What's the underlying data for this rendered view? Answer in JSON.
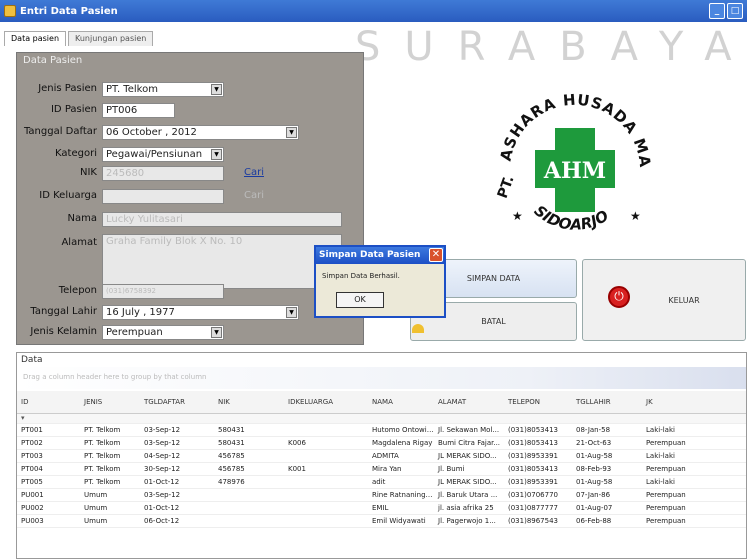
{
  "window": {
    "title": "Entri Data Pasien",
    "watermark": "SURABAYA"
  },
  "tabs": [
    {
      "label": "Data pasien"
    },
    {
      "label": "Kunjungan pasien"
    }
  ],
  "form": {
    "panel_title": "Data Pasien",
    "jenis_pasien_label": "Jenis Pasien",
    "jenis_pasien_value": "PT. Telkom",
    "id_pasien_label": "ID Pasien",
    "id_pasien_value": "PT006",
    "tanggal_daftar_label": "Tanggal Daftar",
    "tanggal_daftar_value": "06  October  , 2012",
    "kategori_label": "Kategori",
    "kategori_value": "Pegawai/Pensiunan",
    "nik_label": "NIK",
    "nik_value": "245680",
    "nik_link": "Cari",
    "id_keluarga_label": "ID Keluarga",
    "id_keluarga_value": "",
    "id_keluarga_link": "Cari",
    "nama_label": "Nama",
    "nama_value": "Lucky Yulitasari",
    "alamat_label": "Alamat",
    "alamat_value": "Graha Family Blok X No. 10",
    "telepon_label": "Telepon",
    "telepon_value": "(031)6758392",
    "tanggal_lahir_label": "Tanggal Lahir",
    "tanggal_lahir_value": "16     July     , 1977",
    "jenis_kelamin_label": "Jenis Kelamin",
    "jenis_kelamin_value": "Perempuan"
  },
  "logo": {
    "abbr": "AHM",
    "top_text": "ASHARA HUSADA MANDIRI",
    "prefix": "PT.",
    "bottom_text": "SIDOARJO"
  },
  "buttons": {
    "simpan": "SIMPAN DATA",
    "batal": "BATAL",
    "keluar": "KELUAR"
  },
  "dialog": {
    "title": "Simpan Data Pasien",
    "message": "Simpan Data Berhasil.",
    "ok": "OK"
  },
  "grid": {
    "title": "Data",
    "group_hint": "Drag a column header here to group by that column",
    "columns": [
      "ID",
      "JENIS",
      "TGLDAFTAR",
      "NIK",
      "IDKELUARGA",
      "NAMA",
      "ALAMAT",
      "TELEPON",
      "TGLLAHIR",
      "JK"
    ],
    "rows": [
      [
        "PT001",
        "PT. Telkom",
        "03-Sep-12",
        "580431",
        "",
        "Hutomo Ontowiryo",
        "Jl. Sekawan Mol...",
        "(031)8053413",
        "08-Jan-58",
        "Laki-laki"
      ],
      [
        "PT002",
        "PT. Telkom",
        "03-Sep-12",
        "580431",
        "K006",
        "Magdalena Rigay",
        "Bumi Citra Fajar...",
        "(031)8053413",
        "21-Oct-63",
        "Perempuan"
      ],
      [
        "PT003",
        "PT. Telkom",
        "04-Sep-12",
        "456785",
        "",
        "ADMITA",
        "JL MERAK SIDO...",
        "(031)8953391",
        "01-Aug-58",
        "Laki-laki"
      ],
      [
        "PT004",
        "PT. Telkom",
        "30-Sep-12",
        "456785",
        "K001",
        "Mira Yan",
        "Jl. Bumi",
        "(031)8053413",
        "08-Feb-93",
        "Perempuan"
      ],
      [
        "PT005",
        "PT. Telkom",
        "01-Oct-12",
        "478976",
        "",
        "adit",
        "JL MERAK SIDO...",
        "(031)8953391",
        "01-Aug-58",
        "Laki-laki"
      ],
      [
        "PU001",
        "Umum",
        "03-Sep-12",
        "",
        "",
        "Rine Ratnaningrum",
        "Jl. Baruk Utara ...",
        "(031)0706770",
        "07-Jan-86",
        "Perempuan"
      ],
      [
        "PU002",
        "Umum",
        "01-Oct-12",
        "",
        "",
        "EMIL",
        "jl. asia afrika 25",
        "(031)0877777",
        "01-Aug-07",
        "Perempuan"
      ],
      [
        "PU003",
        "Umum",
        "06-Oct-12",
        "",
        "",
        "Emil Widyawati",
        "Jl. Pagerwojo 1...",
        "(031)8967543",
        "06-Feb-88",
        "Perempuan"
      ]
    ]
  },
  "colors": {
    "panel": "#9b9690",
    "titlebar": "#2a5cbf",
    "logo_green": "#1e9a3c"
  }
}
